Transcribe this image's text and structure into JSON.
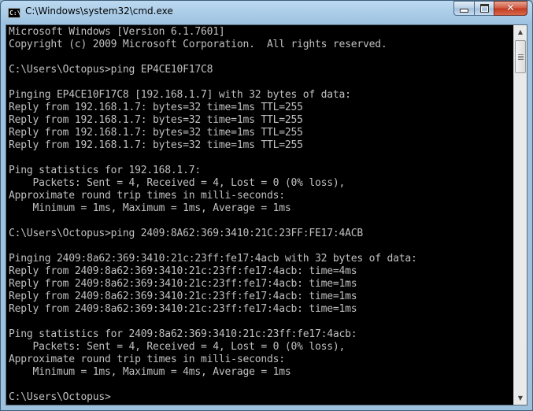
{
  "window": {
    "title": "C:\\Windows\\system32\\cmd.exe",
    "icon": "cmd-icon"
  },
  "buttons": {
    "minimize": "minimize-icon",
    "maximize": "maximize-icon",
    "close_glyph": "✕"
  },
  "console": {
    "lines": [
      "Microsoft Windows [Version 6.1.7601]",
      "Copyright (c) 2009 Microsoft Corporation.  All rights reserved.",
      "",
      "C:\\Users\\Octopus>ping EP4CE10F17C8",
      "",
      "Pinging EP4CE10F17C8 [192.168.1.7] with 32 bytes of data:",
      "Reply from 192.168.1.7: bytes=32 time=1ms TTL=255",
      "Reply from 192.168.1.7: bytes=32 time=1ms TTL=255",
      "Reply from 192.168.1.7: bytes=32 time=1ms TTL=255",
      "Reply from 192.168.1.7: bytes=32 time=1ms TTL=255",
      "",
      "Ping statistics for 192.168.1.7:",
      "    Packets: Sent = 4, Received = 4, Lost = 0 (0% loss),",
      "Approximate round trip times in milli-seconds:",
      "    Minimum = 1ms, Maximum = 1ms, Average = 1ms",
      "",
      "C:\\Users\\Octopus>ping 2409:8A62:369:3410:21C:23FF:FE17:4ACB",
      "",
      "Pinging 2409:8a62:369:3410:21c:23ff:fe17:4acb with 32 bytes of data:",
      "Reply from 2409:8a62:369:3410:21c:23ff:fe17:4acb: time=4ms",
      "Reply from 2409:8a62:369:3410:21c:23ff:fe17:4acb: time=1ms",
      "Reply from 2409:8a62:369:3410:21c:23ff:fe17:4acb: time=1ms",
      "Reply from 2409:8a62:369:3410:21c:23ff:fe17:4acb: time=1ms",
      "",
      "Ping statistics for 2409:8a62:369:3410:21c:23ff:fe17:4acb:",
      "    Packets: Sent = 4, Received = 4, Lost = 0 (0% loss),",
      "Approximate round trip times in milli-seconds:",
      "    Minimum = 1ms, Maximum = 4ms, Average = 1ms",
      "",
      "C:\\Users\\Octopus>"
    ]
  },
  "colors": {
    "console_bg": "#000000",
    "console_text": "#c0c0c0",
    "titlebar": "#9ec3e2",
    "close_button": "#c23a20"
  }
}
